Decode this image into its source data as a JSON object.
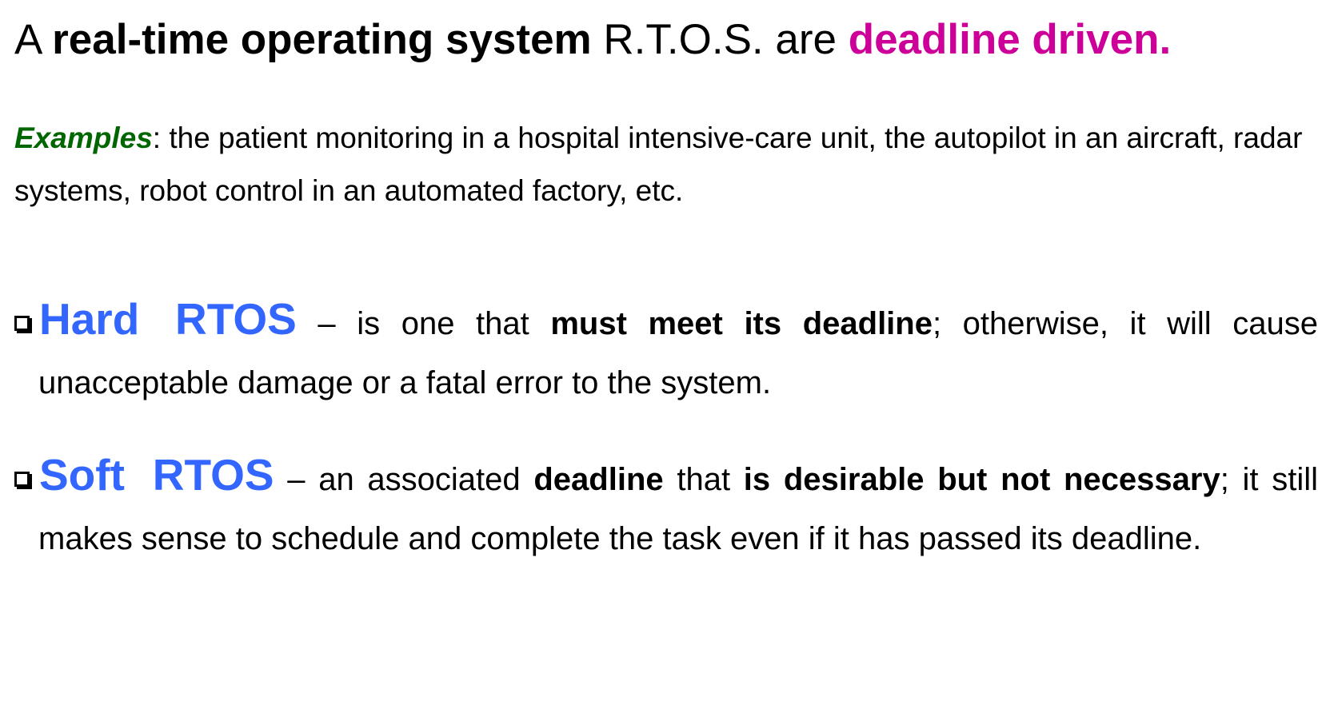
{
  "title": {
    "prefix": "A ",
    "bold": "real-time operating system",
    "middle": " R.T.O.S. are ",
    "highlight": "deadline driven."
  },
  "examples": {
    "label": "Examples",
    "text": ": the patient monitoring in a hospital intensive-care unit, the autopilot in an aircraft, radar systems, robot control in an automated factory, etc."
  },
  "bullets": [
    {
      "term": "Hard RTOS",
      "t1": " – is one that ",
      "b1": "must meet its deadline",
      "t2": "; otherwise, it will cause unacceptable damage or a fatal error to the system."
    },
    {
      "term": "Soft RTOS",
      "t1": " – an associated ",
      "b1": "deadline",
      "t2": " that ",
      "b2": "is desirable but not necessary",
      "t3": "; it still makes sense to schedule and complete the task even if it has passed its deadline."
    }
  ],
  "icons": {
    "bullet": "checkbox-icon"
  },
  "colors": {
    "highlight": "#CC0099",
    "examples_label": "#006600",
    "term": "#3366FF"
  }
}
